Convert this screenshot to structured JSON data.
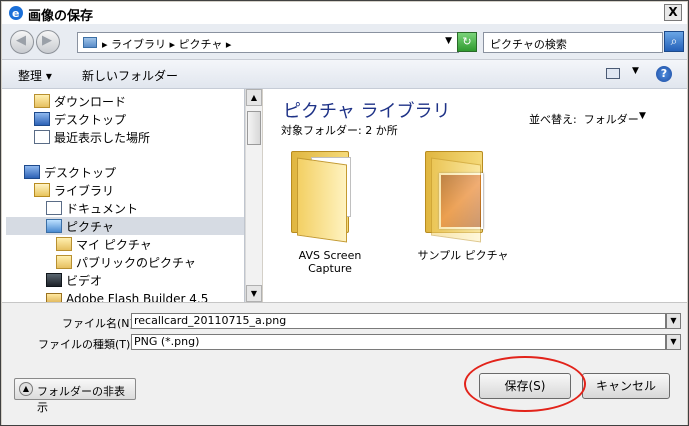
{
  "window": {
    "title": "画像の保存",
    "close_label": "X"
  },
  "address": {
    "breadcrumb": "▸ ライブラリ ▸ ピクチャ ▸",
    "search_placeholder": "ピクチャの検索"
  },
  "toolbar": {
    "organize": "整理 ▾",
    "new_folder": "新しいフォルダー",
    "help": "?"
  },
  "nav": {
    "items": [
      {
        "label": "ダウンロード",
        "icon": "download-folder-icon"
      },
      {
        "label": "デスクトップ",
        "icon": "desktop-icon"
      },
      {
        "label": "最近表示した場所",
        "icon": "recent-places-icon"
      },
      {
        "label": "デスクトップ",
        "icon": "desktop-icon"
      },
      {
        "label": "ライブラリ",
        "icon": "library-icon"
      },
      {
        "label": "ドキュメント",
        "icon": "documents-icon"
      },
      {
        "label": "ピクチャ",
        "icon": "pictures-icon"
      },
      {
        "label": "マイ ピクチャ",
        "icon": "folder-icon"
      },
      {
        "label": "パブリックのピクチャ",
        "icon": "folder-icon"
      },
      {
        "label": "ビデオ",
        "icon": "videos-icon"
      },
      {
        "label": "Adobe Flash Builder 4.5",
        "icon": "folder-icon"
      }
    ]
  },
  "content": {
    "title": "ピクチャ ライブラリ",
    "subtitle": "対象フォルダー: 2 か所",
    "arrange_label": "並べ替え:",
    "arrange_value": "フォルダー",
    "folders": [
      {
        "label": "AVS Screen Capture"
      },
      {
        "label": "サンプル ピクチャ"
      }
    ]
  },
  "form": {
    "filename_label": "ファイル名(N):",
    "filename_value": "recallcard_20110715_a.png",
    "filetype_label": "ファイルの種類(T):",
    "filetype_value": "PNG (*.png)"
  },
  "buttons": {
    "hide_folders": "フォルダーの非表示",
    "save": "保存(S)",
    "cancel": "キャンセル"
  },
  "colors": {
    "annotation_ring": "#e2231a",
    "library_title": "#1e3287"
  }
}
